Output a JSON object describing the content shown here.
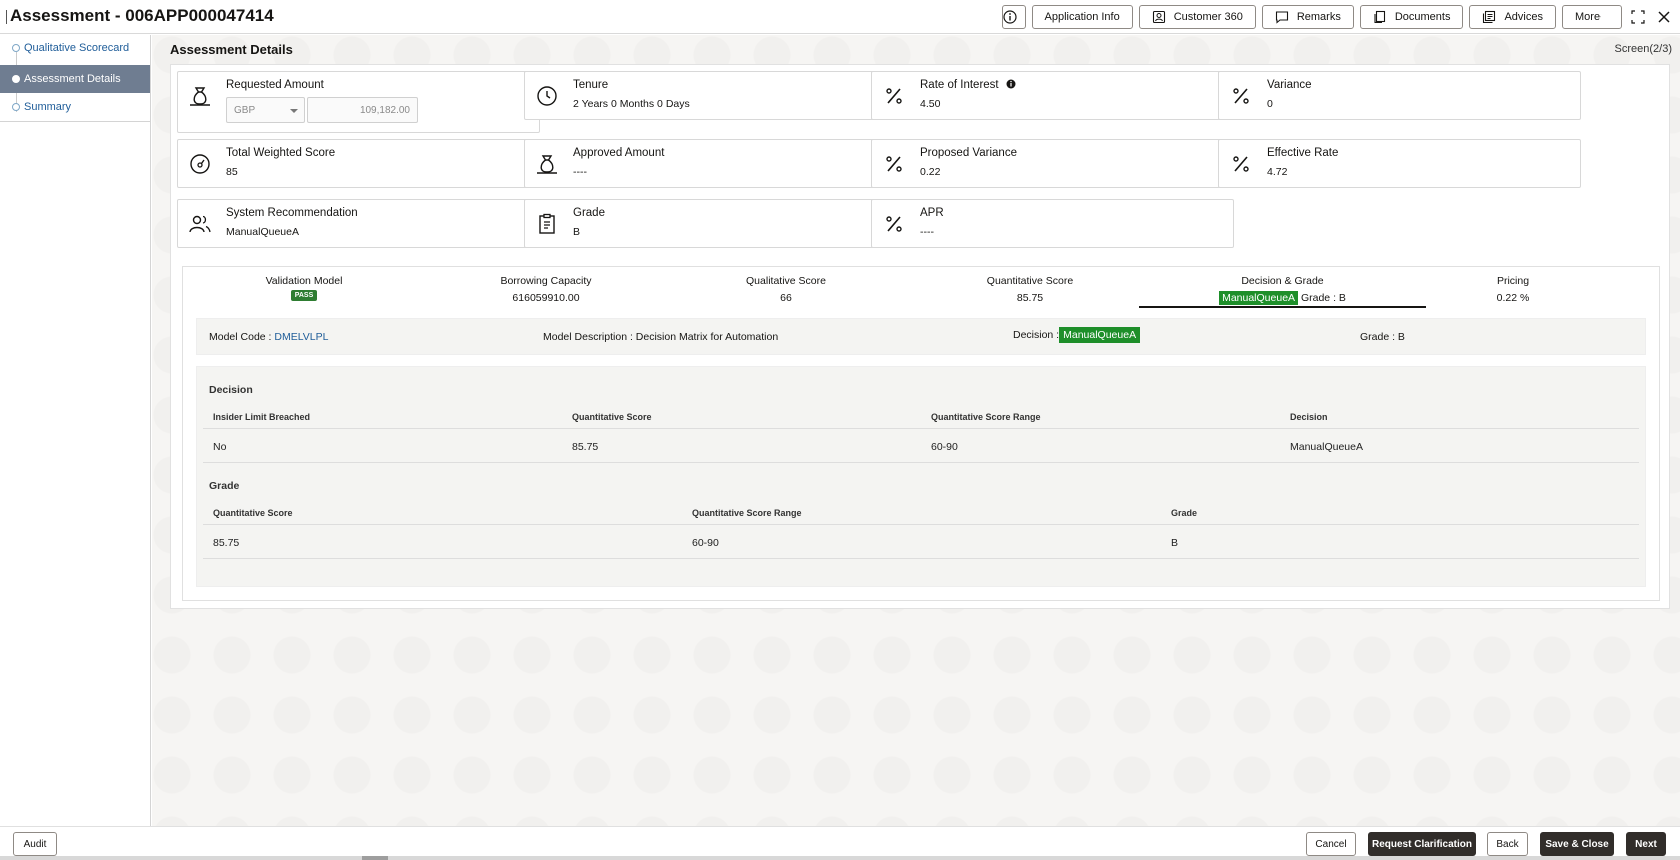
{
  "window": {
    "title": "Assessment - 006APP000047414"
  },
  "header_actions": {
    "info_label": "i",
    "application_info": "Application Info",
    "customer_360": "Customer 360",
    "remarks": "Remarks",
    "documents": "Documents",
    "advices": "Advices",
    "more": "More"
  },
  "sidebar": {
    "items": [
      {
        "label": "Qualitative Scorecard",
        "active": false
      },
      {
        "label": "Assessment Details",
        "active": true
      },
      {
        "label": "Summary",
        "active": false
      }
    ]
  },
  "main": {
    "title": "Assessment Details",
    "screen": "Screen(2/3)"
  },
  "cards": {
    "requested_amount": {
      "label": "Requested Amount",
      "currency": "GBP",
      "amount": "109,182.00"
    },
    "tenure": {
      "label": "Tenure",
      "value": "2 Years 0 Months 0 Days"
    },
    "rate_of_interest": {
      "label": "Rate of Interest",
      "value": "4.50"
    },
    "variance": {
      "label": "Variance",
      "value": "0"
    },
    "total_weighted_score": {
      "label": "Total Weighted Score",
      "value": "85"
    },
    "approved_amount": {
      "label": "Approved Amount",
      "value": "----"
    },
    "proposed_variance": {
      "label": "Proposed Variance",
      "value": "0.22"
    },
    "effective_rate": {
      "label": "Effective Rate",
      "value": "4.72"
    },
    "system_recommendation": {
      "label": "System Recommendation",
      "value": "ManualQueueA"
    },
    "grade": {
      "label": "Grade",
      "value": "B"
    },
    "apr": {
      "label": "APR",
      "value": "----"
    }
  },
  "tabs": {
    "validation_model": {
      "label": "Validation Model",
      "badge": "PASS"
    },
    "borrowing_capacity": {
      "label": "Borrowing Capacity",
      "value": "616059910.00"
    },
    "qualitative_score": {
      "label": "Qualitative Score",
      "value": "66"
    },
    "quantitative_score": {
      "label": "Quantitative Score",
      "value": "85.75"
    },
    "decision_grade": {
      "label": "Decision & Grade",
      "decision": "ManualQueueA",
      "grade": "Grade : B"
    },
    "pricing": {
      "label": "Pricing",
      "value": "0.22 %"
    }
  },
  "model": {
    "code_label": "Model Code :",
    "code": "DMELVLPL",
    "description": "Model Description : Decision Matrix for Automation",
    "decision_label": "Decision :",
    "decision": "ManualQueueA",
    "grade": "Grade : B"
  },
  "decision_table": {
    "title": "Decision",
    "headers": [
      "Insider Limit Breached",
      "Quantitative Score",
      "Quantitative Score Range",
      "Decision"
    ],
    "rows": [
      [
        "No",
        "85.75",
        "60-90",
        "ManualQueueA"
      ]
    ]
  },
  "grade_table": {
    "title": "Grade",
    "headers": [
      "Quantitative Score",
      "Quantitative Score Range",
      "Grade"
    ],
    "rows": [
      [
        "85.75",
        "60-90",
        "B"
      ]
    ]
  },
  "footer": {
    "audit": "Audit",
    "cancel": "Cancel",
    "request_clarification": "Request Clarification",
    "back": "Back",
    "save_close": "Save & Close",
    "next": "Next"
  },
  "colors": {
    "accent_green": "#1e8f2a",
    "sidebar_active": "#6f7d91",
    "link": "#1f5d99",
    "dark_button": "#312d2a"
  }
}
